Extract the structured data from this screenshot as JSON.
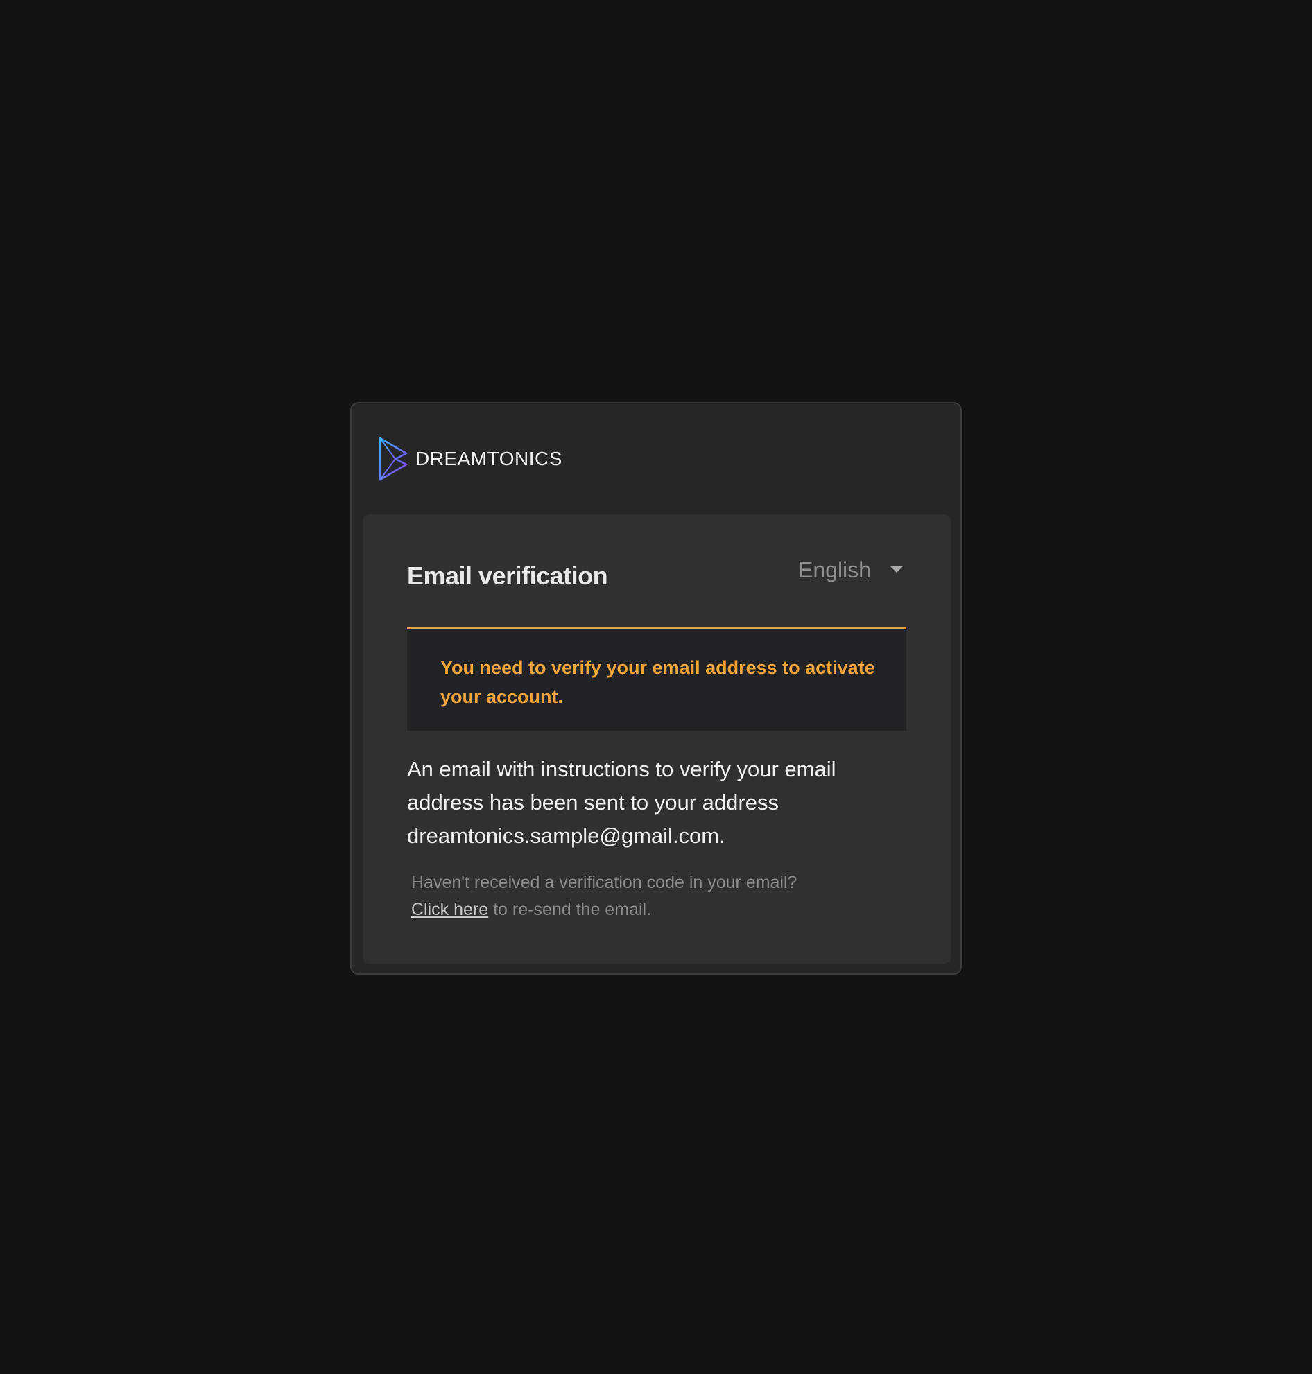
{
  "brand": {
    "name": "DREAMTONICS",
    "logo_icon": "dreamtonics-logo",
    "colors": {
      "logo_gradient_start": "#3aa0ff",
      "logo_gradient_end": "#8a3cff"
    }
  },
  "form": {
    "title": "Email verification",
    "language": {
      "selected": "English",
      "icon": "chevron-down-icon"
    }
  },
  "alert": {
    "message": "You need to verify your email address to activate your account.",
    "color": "#f0a43a"
  },
  "body": {
    "message": "An email with instructions to verify your email address has been sent to your address dreamtonics.sample@gmail.com."
  },
  "resend": {
    "question": "Haven't received a verification code in your email?",
    "link_label": "Click here",
    "suffix": " to re-send the email."
  }
}
